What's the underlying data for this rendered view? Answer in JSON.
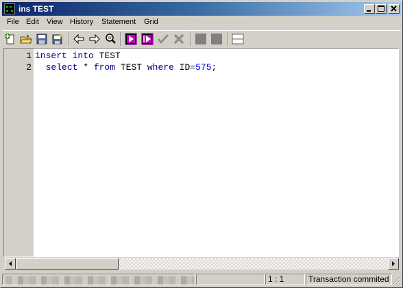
{
  "window": {
    "title": "ins TEST"
  },
  "menu": [
    "File",
    "Edit",
    "View",
    "History",
    "Statement",
    "Grid"
  ],
  "toolbar": {
    "icons": [
      "new-icon",
      "open-icon",
      "save-icon",
      "save-as-icon",
      "back-icon",
      "forward-icon",
      "search-icon",
      "execute-icon",
      "execute-script-icon",
      "commit-icon",
      "rollback-icon",
      "gray-square-icon",
      "gray-square-icon",
      "split-icon"
    ]
  },
  "editor": {
    "line_numbers": [
      "1",
      "2"
    ],
    "lines": [
      {
        "indent": "",
        "tokens": [
          [
            "kw",
            "insert"
          ],
          [
            "t",
            " "
          ],
          [
            "kw",
            "into"
          ],
          [
            "t",
            " TEST"
          ]
        ]
      },
      {
        "indent": "  ",
        "tokens": [
          [
            "kw",
            "select"
          ],
          [
            "t",
            " * "
          ],
          [
            "kw",
            "from"
          ],
          [
            "t",
            " TEST "
          ],
          [
            "kw",
            "where"
          ],
          [
            "t",
            " ID="
          ],
          [
            "num",
            "575"
          ],
          [
            "t",
            ";"
          ]
        ]
      }
    ]
  },
  "status": {
    "cursor": "1 : 1",
    "message": "Transaction commited"
  }
}
